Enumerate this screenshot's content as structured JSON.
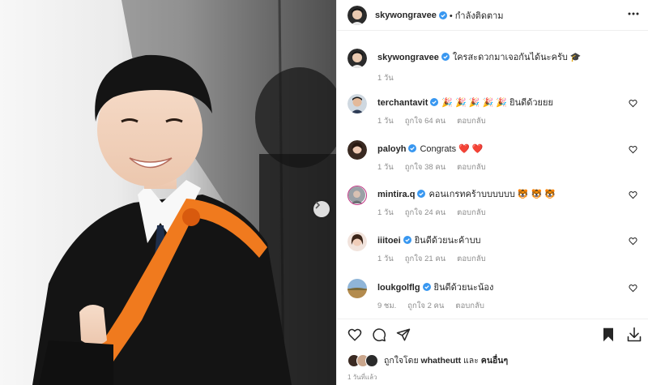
{
  "post": {
    "username": "skywongravee",
    "follow_status": "• กำลังติดตาม",
    "caption": "ใครสะดวกมาเจอกันได้นะครับ 🎓",
    "caption_time": "1 วัน"
  },
  "comments": [
    {
      "username": "terchantavit",
      "text": "🎉 🎉 🎉 🎉 🎉 ยินดีด้วยยย",
      "time": "1 วัน",
      "likes": "ถูกใจ 64 คน",
      "reply": "ตอบกลับ"
    },
    {
      "username": "paloyh",
      "text": "Congrats ❤️ ❤️",
      "time": "1 วัน",
      "likes": "ถูกใจ 38 คน",
      "reply": "ตอบกลับ"
    },
    {
      "username": "mintira.q",
      "text": "คอนเกรทคร้าบบบบบบ 🐯 🐯 🐯",
      "time": "1 วัน",
      "likes": "ถูกใจ 24 คน",
      "reply": "ตอบกลับ"
    },
    {
      "username": "iiitoei",
      "text": "ยินดีด้วยนะค้าบบ",
      "time": "1 วัน",
      "likes": "ถูกใจ 21 คน",
      "reply": "ตอบกลับ"
    },
    {
      "username": "loukgolflg",
      "text": "ยินดีด้วยนะน้อง",
      "time": "9 ชม.",
      "likes": "ถูกใจ 2 คน",
      "reply": "ตอบกลับ"
    }
  ],
  "likes_line": {
    "prefix": "ถูกใจโดย",
    "user": "whatheutt",
    "and": "และ",
    "others": "คนอื่นๆ"
  },
  "post_age": "1 วันที่แล้ว",
  "icons": {
    "header_more": "more-dots-icon",
    "like": "heart-icon",
    "comment": "comment-bubble-icon",
    "share": "send-icon",
    "save": "bookmark-icon",
    "download": "download-icon",
    "carousel_next": "chevron-right-icon",
    "comment_like": "heart-outline-icon",
    "verified": "verified-badge-icon"
  },
  "colors": {
    "verified": "#3897f0",
    "text": "#262626",
    "muted": "#8e8e8e",
    "sash": "#f07a1e"
  }
}
